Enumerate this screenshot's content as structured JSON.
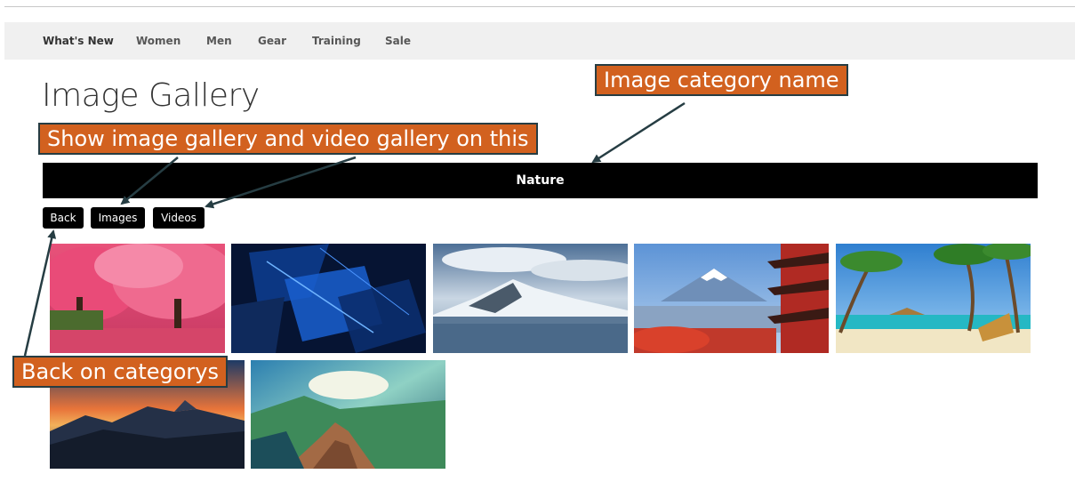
{
  "nav": {
    "items": [
      {
        "label": "What's New"
      },
      {
        "label": "Women"
      },
      {
        "label": "Men"
      },
      {
        "label": "Gear"
      },
      {
        "label": "Training"
      },
      {
        "label": "Sale"
      }
    ]
  },
  "page": {
    "title": "Image Gallery"
  },
  "category": {
    "name": "Nature"
  },
  "buttons": {
    "back": "Back",
    "images": "Images",
    "videos": "Videos"
  },
  "gallery": {
    "images": [
      {
        "subject": "pink blossom trees"
      },
      {
        "subject": "abstract blue shards"
      },
      {
        "subject": "snowy mountain lake"
      },
      {
        "subject": "mount fuji pagoda"
      },
      {
        "subject": "tropical beach palms"
      },
      {
        "subject": "volcano sunset"
      },
      {
        "subject": "mountain ridge valley"
      }
    ]
  },
  "annotations": {
    "category_callout": "Image category name",
    "gallery_callout": "Show image gallery and video gallery on this",
    "back_callout": "Back on categorys"
  },
  "colors": {
    "callout_bg": "#d2611f",
    "callout_border": "#263d43",
    "arrow": "#263d43",
    "category_bar": "#000000",
    "navbar_bg": "#f0f0f0"
  }
}
